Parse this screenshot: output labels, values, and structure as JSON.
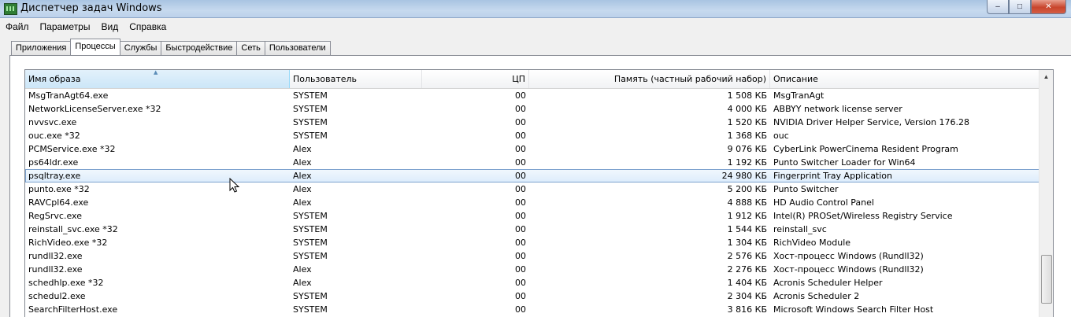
{
  "window": {
    "title": "Диспетчер задач Windows",
    "caption_buttons": {
      "minimize": "–",
      "maximize": "□",
      "close": "✕"
    }
  },
  "menu": [
    "Файл",
    "Параметры",
    "Вид",
    "Справка"
  ],
  "tabs": [
    {
      "label": "Приложения",
      "active": false
    },
    {
      "label": "Процессы",
      "active": true
    },
    {
      "label": "Службы",
      "active": false
    },
    {
      "label": "Быстродействие",
      "active": false
    },
    {
      "label": "Сеть",
      "active": false
    },
    {
      "label": "Пользователи",
      "active": false
    }
  ],
  "table": {
    "columns": {
      "name": "Имя образа",
      "user": "Пользователь",
      "cpu": "ЦП",
      "mem": "Память (частный рабочий набор)",
      "desc": "Описание"
    },
    "sort_indicator": "▲",
    "selected_index": 6,
    "rows": [
      {
        "name": "MsgTranAgt64.exe",
        "user": "SYSTEM",
        "cpu": "00",
        "mem": "1 508 КБ",
        "desc": "MsgTranAgt"
      },
      {
        "name": "NetworkLicenseServer.exe *32",
        "user": "SYSTEM",
        "cpu": "00",
        "mem": "4 000 КБ",
        "desc": "ABBYY network license server"
      },
      {
        "name": "nvvsvc.exe",
        "user": "SYSTEM",
        "cpu": "00",
        "mem": "1 520 КБ",
        "desc": "NVIDIA Driver Helper Service, Version 176.28"
      },
      {
        "name": "ouc.exe *32",
        "user": "SYSTEM",
        "cpu": "00",
        "mem": "1 368 КБ",
        "desc": "ouc"
      },
      {
        "name": "PCMService.exe *32",
        "user": "Alex",
        "cpu": "00",
        "mem": "9 076 КБ",
        "desc": "CyberLink PowerCinema Resident Program"
      },
      {
        "name": "ps64ldr.exe",
        "user": "Alex",
        "cpu": "00",
        "mem": "1 192 КБ",
        "desc": "Punto Switcher Loader for Win64"
      },
      {
        "name": "psqltray.exe",
        "user": "Alex",
        "cpu": "00",
        "mem": "24 980 КБ",
        "desc": "Fingerprint Tray Application"
      },
      {
        "name": "punto.exe *32",
        "user": "Alex",
        "cpu": "00",
        "mem": "5 200 КБ",
        "desc": "Punto Switcher"
      },
      {
        "name": "RAVCpl64.exe",
        "user": "Alex",
        "cpu": "00",
        "mem": "4 888 КБ",
        "desc": "HD Audio Control Panel"
      },
      {
        "name": "RegSrvc.exe",
        "user": "SYSTEM",
        "cpu": "00",
        "mem": "1 912 КБ",
        "desc": "Intel(R) PROSet/Wireless Registry Service"
      },
      {
        "name": "reinstall_svc.exe *32",
        "user": "SYSTEM",
        "cpu": "00",
        "mem": "1 544 КБ",
        "desc": "reinstall_svc"
      },
      {
        "name": "RichVideo.exe *32",
        "user": "SYSTEM",
        "cpu": "00",
        "mem": "1 304 КБ",
        "desc": "RichVideo Module"
      },
      {
        "name": "rundll32.exe",
        "user": "SYSTEM",
        "cpu": "00",
        "mem": "2 576 КБ",
        "desc": "Хост-процесс Windows (Rundll32)"
      },
      {
        "name": "rundll32.exe",
        "user": "Alex",
        "cpu": "00",
        "mem": "2 276 КБ",
        "desc": "Хост-процесс Windows (Rundll32)"
      },
      {
        "name": "schedhlp.exe *32",
        "user": "Alex",
        "cpu": "00",
        "mem": "1 404 КБ",
        "desc": "Acronis Scheduler Helper"
      },
      {
        "name": "schedul2.exe",
        "user": "SYSTEM",
        "cpu": "00",
        "mem": "2 304 КБ",
        "desc": "Acronis Scheduler 2"
      },
      {
        "name": "SearchFilterHost.exe",
        "user": "SYSTEM",
        "cpu": "00",
        "mem": "3 816 КБ",
        "desc": "Microsoft Windows Search Filter Host"
      }
    ]
  },
  "scrollbar": {
    "up_arrow": "▲",
    "position": 0.92
  }
}
